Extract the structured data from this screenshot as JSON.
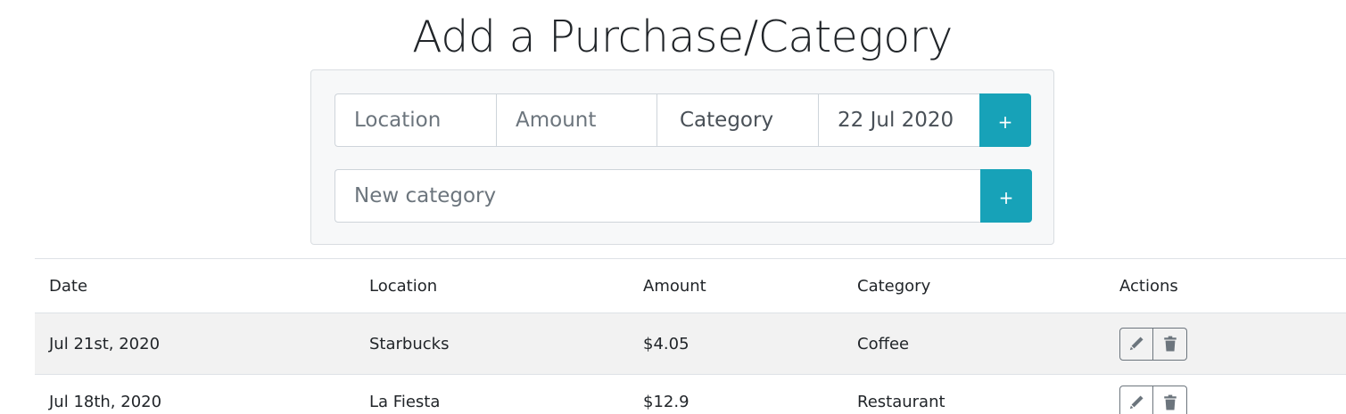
{
  "title": "Add a Purchase/Category",
  "purchase_form": {
    "location_placeholder": "Location",
    "amount_placeholder": "Amount",
    "category_label": "Category",
    "date_value": "22 Jul 2020",
    "add_label": "+"
  },
  "category_form": {
    "new_category_placeholder": "New category",
    "add_label": "+"
  },
  "table": {
    "headers": [
      "Date",
      "Location",
      "Amount",
      "Category",
      "Actions"
    ],
    "rows": [
      {
        "date": "Jul 21st, 2020",
        "location": "Starbucks",
        "amount": "$4.05",
        "category": "Coffee"
      },
      {
        "date": "Jul 18th, 2020",
        "location": "La Fiesta",
        "amount": "$12.9",
        "category": "Restaurant"
      }
    ],
    "action_icons": [
      "pencil-icon",
      "trash-icon"
    ]
  },
  "colors": {
    "accent": "#17a2b8",
    "card_background": "#f7f8f9",
    "row_shade": "#f2f2f2"
  }
}
